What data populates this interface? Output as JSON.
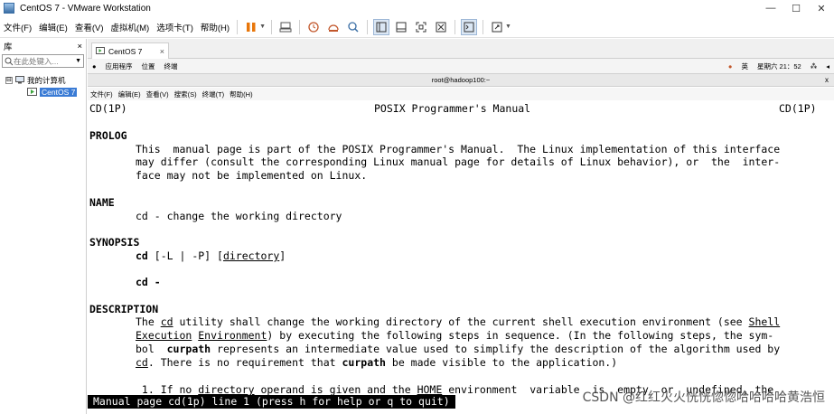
{
  "window": {
    "title": "CentOS 7 - VMware Workstation",
    "minimize": "—",
    "maximize": "☐",
    "close": "✕"
  },
  "menu": [
    "文件(F)",
    "编辑(E)",
    "查看(V)",
    "虚拟机(M)",
    "选项卡(T)",
    "帮助(H)"
  ],
  "sidebar": {
    "title": "库",
    "close": "×",
    "search_placeholder": "在此处键入...",
    "root": "我的计算机",
    "vm": "CentOS 7",
    "expand": "⊟"
  },
  "tab": {
    "label": "CentOS 7",
    "close": "×"
  },
  "gnome": {
    "apps": "应用程序",
    "places": "位置",
    "terminal": "终端",
    "lang": "英",
    "clock": "星期六 21：52"
  },
  "terminal_window": {
    "title": "root@hadoop100:~",
    "close": "x",
    "menu": [
      "文件(F)",
      "编辑(E)",
      "查看(V)",
      "搜索(S)",
      "终端(T)",
      "帮助(H)"
    ]
  },
  "man": {
    "header_left": "CD(1P)",
    "header_center": "POSIX Programmer's Manual",
    "header_right": "CD(1P)",
    "prolog_title": "PROLOG",
    "prolog_1": "This  manual page is part of the POSIX Programmer's Manual.  The Linux implementation of this interface",
    "prolog_2": "may differ (consult the corresponding Linux manual page for details of Linux behavior), or  the  inter-",
    "prolog_3": "face may not be implemented on Linux.",
    "name_title": "NAME",
    "name_1": "cd - change the working directory",
    "synopsis_title": "SYNOPSIS",
    "syn_cmd": "cd",
    "syn_opts": " [-L | -P] [",
    "syn_dir": "directory",
    "syn_close": "]",
    "syn_2": "cd -",
    "desc_title": "DESCRIPTION",
    "desc_1a": "The ",
    "desc_1b": "cd",
    "desc_1c": " utility shall change the working directory of the current shell execution environment (see ",
    "desc_1d": "Shell",
    "desc_2a": "Execution",
    "desc_2b": " ",
    "desc_2c": "Environment",
    "desc_2d": ") by executing the following steps in sequence. (In the following steps, the sym-",
    "desc_3a": "bol  ",
    "desc_3b": "curpath",
    "desc_3c": " represents an intermediate value used to simplify the description of the algorithm used by",
    "desc_4a": "cd",
    "desc_4b": ". There is no requirement that ",
    "desc_4c": "curpath",
    "desc_4d": " be made visible to the application.)",
    "step_1a": " 1. If no ",
    "step_1b": "directory",
    "step_1c": " operand is given and the ",
    "step_1d": "HOME",
    "step_1e": " environment  variable  is  empty  or  undefined, the",
    "status": "Manual page cd(1p) line 1 (press h for help or q to quit)"
  },
  "watermark": "CSDN @红红火火恍恍惚惚哈哈哈哈黄浩恒"
}
